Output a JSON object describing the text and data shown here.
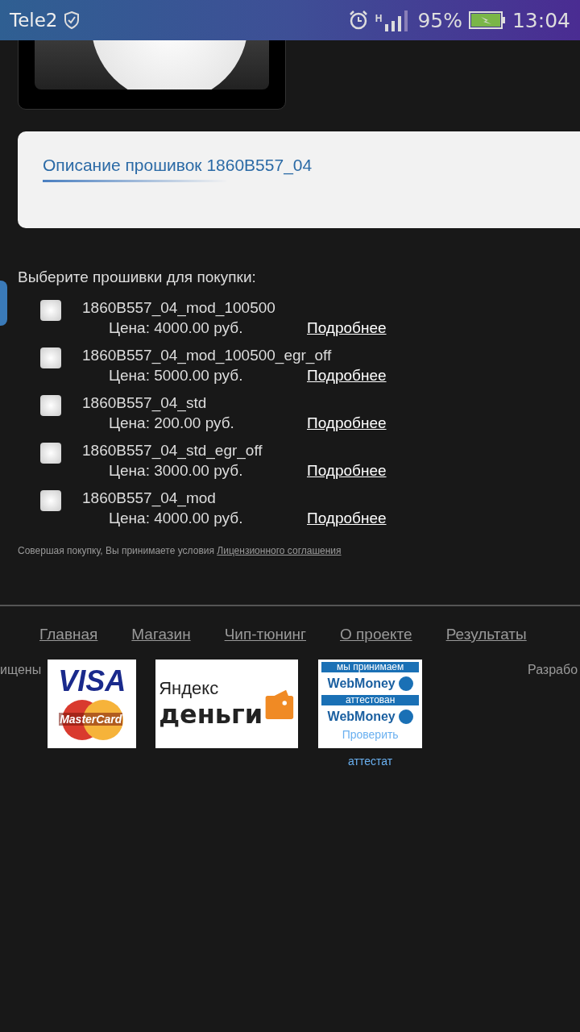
{
  "status_bar": {
    "carrier": "Tele2",
    "network": "H",
    "battery": "95%",
    "time": "13:04"
  },
  "description_panel": {
    "title": "Описание прошивок 1860B557_04"
  },
  "firmware_section": {
    "heading": "Выберите прошивки для покупки:",
    "items": [
      {
        "name": "1860B557_04_mod_100500",
        "price": "Цена: 4000.00 руб.",
        "link": "Подробнее",
        "checked": false
      },
      {
        "name": "1860B557_04_mod_100500_egr_off",
        "price": "Цена: 5000.00 руб.",
        "link": "Подробнее",
        "checked": false
      },
      {
        "name": "1860B557_04_std",
        "price": "Цена: 200.00 руб.",
        "link": "Подробнее",
        "checked": false
      },
      {
        "name": "1860B557_04_std_egr_off",
        "price": "Цена: 3000.00 руб.",
        "link": "Подробнее",
        "checked": false
      },
      {
        "name": "1860B557_04_mod",
        "price": "Цена: 4000.00 руб.",
        "link": "Подробнее",
        "checked": false
      }
    ],
    "agreement": {
      "text": "Совершая покупку, Вы принимаете условия",
      "link": "Лицензионного соглашения"
    }
  },
  "footer": {
    "nav": [
      "Главная",
      "Магазин",
      "Чип-тюнинг",
      "О проекте",
      "Результаты"
    ],
    "left_text": "ищены",
    "right_text": "Разрабо",
    "visa_logo": {
      "visa": "VISA",
      "mastercard": "MasterCard"
    },
    "yandex_logo": {
      "line_1": "Яндекс",
      "line_2": "деньги"
    },
    "webmoney_logo": {
      "accept": "мы принимаем",
      "brand_1": "WebMoney",
      "attested": "аттестован",
      "brand_2": "WebMoney",
      "check": "Проверить"
    },
    "attestat_link": "аттестат"
  }
}
